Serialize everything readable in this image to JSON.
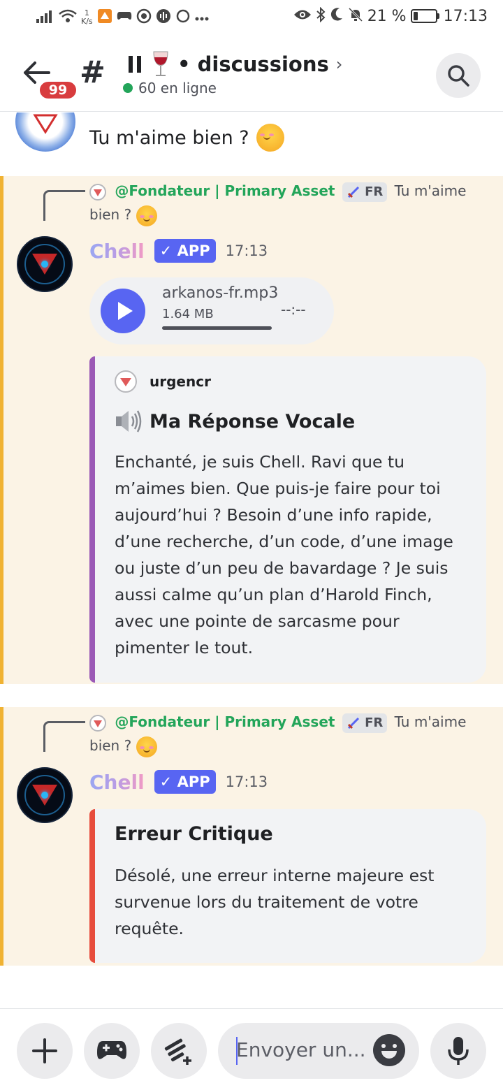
{
  "status_bar": {
    "speed_value": "1",
    "speed_unit": "K/s",
    "battery_percent": "21 %",
    "battery_level": 0.21,
    "time": "17:13"
  },
  "header": {
    "unread_count": "99",
    "channel_prefix": "#",
    "channel_name": "• discussions",
    "online": "60 en ligne"
  },
  "messages": {
    "top": {
      "text": "Tu m'aime bien ?"
    },
    "msg1": {
      "reply_mention": "@Fondateur | Primary Asset",
      "reply_tag": "FR",
      "reply_text": "Tu m'aime bien ?",
      "author": "Chell",
      "app_tag": "✓ APP",
      "time": "17:13",
      "audio": {
        "file_name": "arkanos-fr.mp3",
        "file_size": "1.64 MB",
        "duration": "--:--"
      },
      "embed": {
        "author": "urgencr",
        "title": "Ma Réponse Vocale",
        "description": "Enchanté, je suis Chell. Ravi que tu m’aimes bien. Que puis-je faire pour toi aujourd’hui ? Besoin d’une info rapide, d’une recherche, d’un code, d’une image ou juste d’un peu de bavardage ? Je suis aussi calme qu’un plan d’Harold Finch, avec une pointe de sarcasme pour pimenter le tout."
      }
    },
    "msg2": {
      "reply_mention": "@Fondateur | Primary Asset",
      "reply_tag": "FR",
      "reply_text": "Tu m'aime bien ?",
      "author": "Chell",
      "app_tag": "✓ APP",
      "time": "17:13",
      "embed": {
        "title": "Erreur Critique",
        "description": "Désolé, une erreur interne majeure est survenue lors du traitement de votre requête."
      }
    }
  },
  "composer": {
    "placeholder": "Envoyer un..."
  },
  "colors": {
    "blurple": "#5865f2",
    "online_green": "#23a55a",
    "highlight_bg": "#fbf3e5",
    "highlight_bar": "#f0b232",
    "embed_purple": "#9b59b6",
    "embed_red": "#e74c3c"
  }
}
